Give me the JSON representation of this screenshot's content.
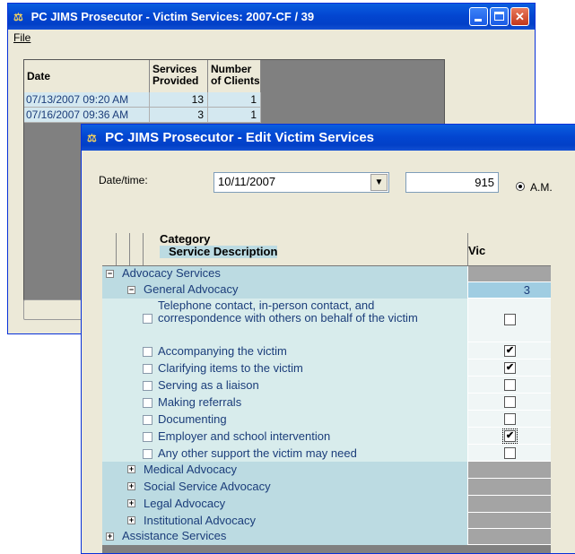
{
  "back_window": {
    "title": "PC JIMS Prosecutor - Victim Services: 2007-CF / 39",
    "menu_file": "File",
    "grid": {
      "headers": [
        "Date",
        "Services Provided",
        "Number of Clients"
      ],
      "rows": [
        {
          "date": "07/13/2007 09:20 AM",
          "services": "13",
          "clients": "1"
        },
        {
          "date": "07/16/2007 09:36 AM",
          "services": "3",
          "clients": "1"
        }
      ]
    }
  },
  "front_window": {
    "title": "PC JIMS Prosecutor - Edit Victim Services",
    "date_label": "Date/time:",
    "date_value": "10/11/2007",
    "time_value": "915",
    "ampm_label": "A.M.",
    "tree": {
      "header_category": "Category",
      "header_service": "Service Description",
      "header_vic": "Vic",
      "rows": [
        {
          "label": "Advocacy Services",
          "expander": "−"
        },
        {
          "label": "General Advocacy",
          "expander": "−",
          "vic": "3"
        },
        {
          "label": "Telephone contact, in-person contact, and correspondence with others on behalf of the victim",
          "checked": false
        },
        {
          "label": "Accompanying the victim",
          "checked": true
        },
        {
          "label": "Clarifying items to the victim",
          "checked": true
        },
        {
          "label": "Serving as a liaison",
          "checked": false
        },
        {
          "label": "Making referrals",
          "checked": false
        },
        {
          "label": "Documenting",
          "checked": false
        },
        {
          "label": "Employer and school intervention",
          "checked": true
        },
        {
          "label": "Any other support the victim may need",
          "checked": false
        },
        {
          "label": "Medical Advocacy",
          "expander": "+"
        },
        {
          "label": "Social Service Advocacy",
          "expander": "+"
        },
        {
          "label": "Legal Advocacy",
          "expander": "+"
        },
        {
          "label": "Institutional Advocacy",
          "expander": "+"
        },
        {
          "label": "Assistance Services",
          "expander": "+"
        }
      ]
    }
  }
}
